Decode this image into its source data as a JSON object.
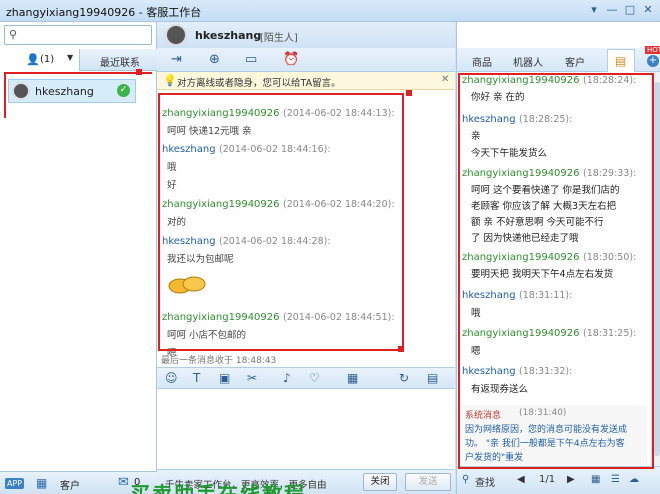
{
  "window": {
    "title": "zhangyixiang19940926 - 客服工作台"
  },
  "left": {
    "contacts_tab": {
      "count": "(1)"
    },
    "recent_tab": "最近联系",
    "contacts": [
      {
        "name": "hkeszhang"
      }
    ],
    "bottom": {
      "app_label": "APP",
      "service_label": "客户",
      "mail_count": "0"
    }
  },
  "chat": {
    "peer_name": "hkeszhang",
    "peer_tag": "[陌生人]",
    "tip": "对方离线或者隐身，您可以给TA留言。",
    "messages": [
      {
        "sender": "zhangyixiang19940926",
        "time": "(2014-06-02 18:44:13):",
        "lines": [
          "呵呵  快递12元哦   亲"
        ]
      },
      {
        "sender": "hkeszhang",
        "time": "(2014-06-02 18:44:16):",
        "lines": [
          "哦",
          "好"
        ]
      },
      {
        "sender": "zhangyixiang19940926",
        "time": "(2014-06-02 18:44:20):",
        "lines": [
          "对的"
        ]
      },
      {
        "sender": "hkeszhang",
        "time": "(2014-06-02 18:44:28):",
        "lines": [
          "我还以为包邮呢"
        ]
      },
      {
        "sender": "zhangyixiang19940926",
        "time": "(2014-06-02 18:44:51):",
        "lines": [
          "呵呵   小店不包邮的",
          "嗯"
        ]
      }
    ],
    "last_msg": "最后一条消息收于 18:48:43",
    "footer": {
      "slogan": "千牛卖家工作台，更高效率，更多自由",
      "close_label": "关闭",
      "send_label": "发送"
    }
  },
  "right": {
    "tabs": [
      "商品",
      "机器人",
      "客户"
    ],
    "hot_badge": "HOT",
    "messages": [
      {
        "sender": "zhangyixiang19940926",
        "time": "(18:28:24):",
        "lines": [
          "你好   亲  在的"
        ]
      },
      {
        "sender": "hkeszhang",
        "time": "(18:28:25):",
        "lines": [
          "亲",
          "今天下午能发货么"
        ]
      },
      {
        "sender": "zhangyixiang19940926",
        "time": "(18:29:33):",
        "lines": [
          "呵呵  这个要看快递了  你是我们店的",
          "老顾客 你应该了解  大概3天左右把",
          "额    亲   不好意思啊  今天可能不行",
          "了  因为快递他已经走了哦"
        ]
      },
      {
        "sender": "zhangyixiang19940926",
        "time": "(18:30:50):",
        "lines": [
          "要明天把   我明天下午4点左右发货"
        ]
      },
      {
        "sender": "hkeszhang",
        "time": "(18:31:11):",
        "lines": [
          "哦"
        ]
      },
      {
        "sender": "zhangyixiang19940926",
        "time": "(18:31:25):",
        "lines": [
          "嗯"
        ]
      },
      {
        "sender": "hkeszhang",
        "time": "(18:31:32):",
        "lines": [
          "有返现券送么"
        ]
      }
    ],
    "system": {
      "title": "系统消息",
      "time": "(18:31:40)",
      "lines": [
        "因为网络原因，您的消息可能没有发送成",
        "功。  \"亲   我们一般都是下午4点左右为客",
        "户发货的\"重发"
      ]
    },
    "footer": {
      "search_label": "查找",
      "page": "1/1"
    }
  },
  "banner": {
    "text": "买卖助手在线教程"
  }
}
